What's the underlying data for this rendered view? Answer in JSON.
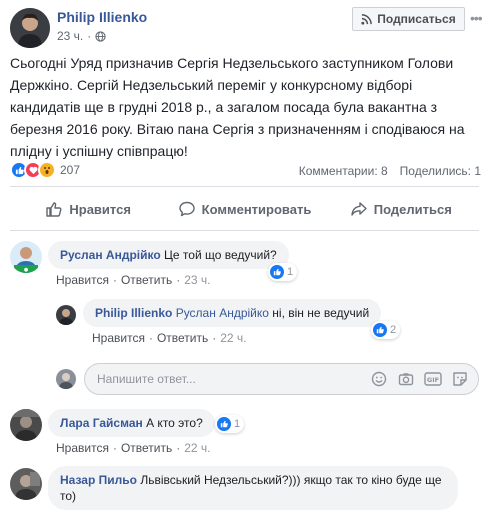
{
  "post": {
    "author": "Philip Illienko",
    "time": "23 ч.",
    "subscribe_label": "Подписаться",
    "text": "Сьогодні Уряд призначив Сергія Недзельського заступником Голови Держкіно. Сергій Недзельський переміг у конкурсному відборі кандидатів ще в грудні 2018 р., а загалом посада була вакантна з березня 2016 року. Вітаю пана Сергія з призначенням і сподіваюся на плідну і успішну співпрацю!",
    "reactions_count": "207",
    "comments_count": "Комментарии: 8",
    "shares_count": "Поделились: 1"
  },
  "actions": {
    "like": "Нравится",
    "comment": "Комментировать",
    "share": "Поделиться"
  },
  "comments": [
    {
      "name": "Руслан Андрійко",
      "text": "Це той що ведучий?",
      "like": "Нравится",
      "reply": "Ответить",
      "time": "23 ч.",
      "likes": "1"
    },
    {
      "name": "Philip Illienko",
      "tag": "Руслан Андрійко",
      "text": "ні, він не ведучий",
      "like": "Нравится",
      "reply": "Ответить",
      "time": "22 ч.",
      "likes": "2"
    },
    {
      "name": "Лара Гайсман",
      "text": "А кто это?",
      "like": "Нравится",
      "reply": "Ответить",
      "time": "22 ч.",
      "likes": "1"
    },
    {
      "name": "Назар Пильо",
      "text": "Львівський Недзельський?))) якщо так то кіно буде ще то)"
    }
  ],
  "reply_box": {
    "placeholder": "Напишите ответ..."
  },
  "icons": [
    "globe-icon",
    "rss-icon",
    "more-icon",
    "like-icon",
    "love-icon",
    "wow-icon",
    "thumbs-up-icon",
    "comment-icon",
    "share-icon",
    "emoji-icon",
    "camera-icon",
    "gif-icon",
    "sticker-icon"
  ],
  "colors": {
    "link": "#385898",
    "like_blue": "#1877f2",
    "love_red": "#f33e58",
    "wow_yellow": "#f7b125"
  }
}
